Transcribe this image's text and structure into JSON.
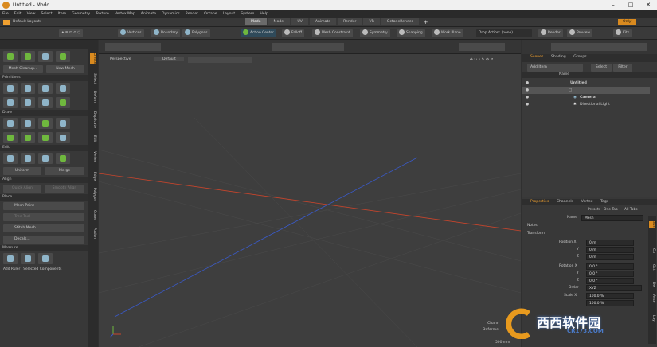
{
  "window": {
    "title": "Untitled - Modo",
    "min": "–",
    "max": "□",
    "close": "✕"
  },
  "menu": [
    "File",
    "Edit",
    "View",
    "Select",
    "Item",
    "Geometry",
    "Texture",
    "Vertex Map",
    "Animate",
    "Dynamics",
    "Render",
    "Octane",
    "Layout",
    "System",
    "Help"
  ],
  "layout": {
    "label": "Default Layouts",
    "tabs": [
      "Modo",
      "Model",
      "UV",
      "Animate",
      "Render",
      "VR",
      "OctaneRender"
    ],
    "add": "+",
    "only": "Only"
  },
  "toolbar": {
    "vertices": "Vertices",
    "boundary": "Boundary",
    "polygons": "Polygons",
    "action_center": "Action Center",
    "falloff": "Falloff",
    "mesh_constraint": "Mesh Constraint",
    "symmetry": "Symmetry",
    "snapping": "Snapping",
    "work_plane": "Work Plane",
    "drop_action": "Drop Action: (none)",
    "render": "Render",
    "preview": "Preview",
    "kits": "Kits"
  },
  "left": {
    "mesh_cleanup": "Mesh Cleanup...",
    "new_mesh": "New Mesh",
    "sections": {
      "primitives": "Primitives",
      "draw": "Draw",
      "edit": "Edit",
      "align": "Align",
      "place": "Place",
      "measure": "Measure"
    },
    "uniform": "Uniform",
    "merge": "Merge",
    "quick_align": "Quick Align",
    "smooth_align": "Smooth Align",
    "mesh_paint": "Mesh Paint",
    "tree_tool": "Tree Tool",
    "stitch_mesh": "Stitch Mesh...",
    "decals": "Decals...",
    "add_ruler": "Add Ruler",
    "selected_components": "Selected Components"
  },
  "vtabs": [
    "Create",
    "Select",
    "Deform",
    "Duplicate",
    "Edit",
    "Vertex",
    "Edge",
    "Polygon",
    "Curve",
    "Fusion"
  ],
  "viewport": {
    "view": "Perspective",
    "shading": "Default",
    "readout_partial": "Chann",
    "readout2": "Deforme",
    "readout3": "500 mm"
  },
  "scene": {
    "tabs": [
      "Scenes",
      "Shading",
      "Groups"
    ],
    "add_item": "Add Item",
    "select": "Select",
    "filter": "Filter",
    "name_col": "Name",
    "items": [
      "Untitled",
      "",
      "Camera",
      "Directional Light"
    ]
  },
  "properties": {
    "tabs": [
      "Properties",
      "Channels",
      "Vertex",
      "Tags"
    ],
    "presets": "Presets",
    "one_tab": "One Tab",
    "all_tabs": "All Tabs",
    "name_label": "Name",
    "name_value": "Mesh",
    "notes": "Notes",
    "transform": "Transform",
    "position": {
      "label": "Position X",
      "x": "0 m",
      "y": "0 m",
      "z": "0 m"
    },
    "rotation": {
      "label": "Rotation X",
      "x": "0.0 °",
      "y": "0.0 °",
      "z": "0.0 °"
    },
    "order_label": "Order",
    "order_value": "XYZ",
    "scale_label": "Scale X",
    "scale_x": "100.0 %",
    "scale_y": "100.0 %",
    "y": "Y",
    "z": "Z"
  },
  "side_tabs": [
    "Surf",
    "Cu",
    "Oct",
    "De",
    "Asse",
    "Lay"
  ],
  "watermark": {
    "text": "西西软件园",
    "url": "CR173.COM"
  },
  "colors": {
    "accent": "#f0a030",
    "green": "#6fb83e",
    "x_axis": "#c8452c",
    "z_axis": "#3a5ac8"
  }
}
